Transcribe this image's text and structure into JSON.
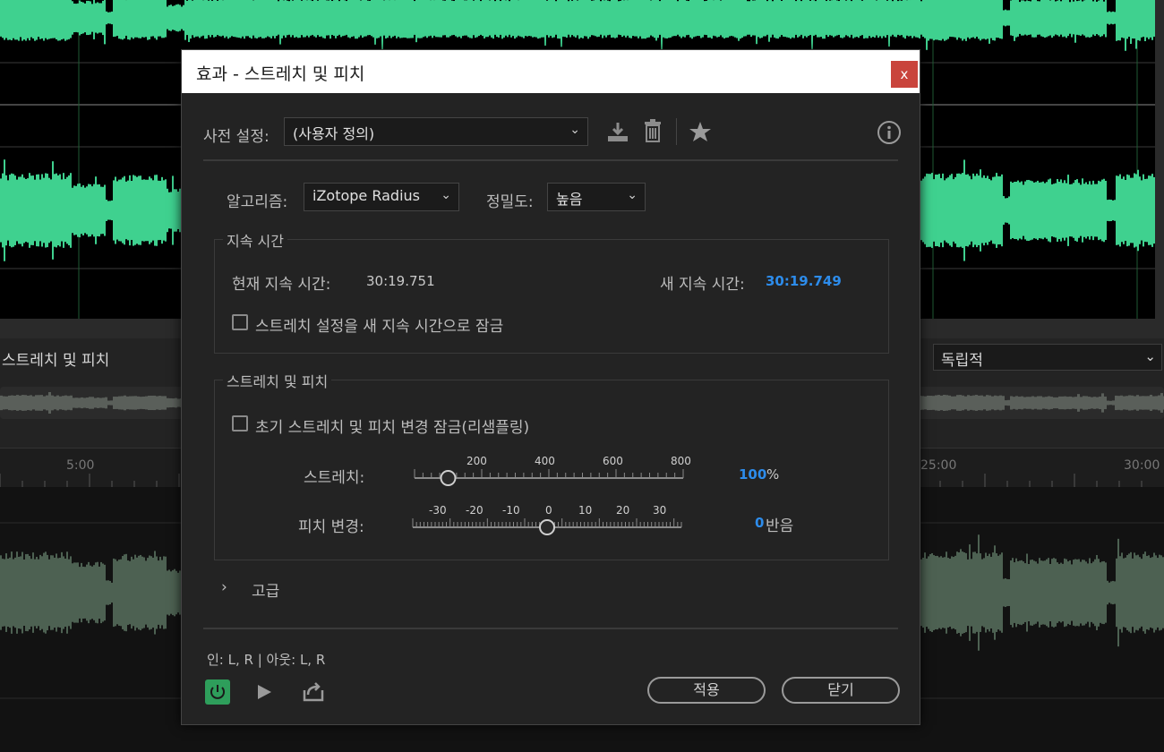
{
  "background": {
    "panel_label": "스트레치 및 피치",
    "right_select_value": "독립적",
    "ruler_labels": [
      "5:00",
      "25:00",
      "30:00"
    ]
  },
  "dialog": {
    "title": "효과 - 스트레치 및 피치",
    "close_label": "x",
    "preset": {
      "label": "사전 설정:",
      "value": "(사용자 정의)"
    },
    "algorithm": {
      "label": "알고리즘:",
      "value": "iZotope Radius"
    },
    "precision": {
      "label": "정밀도:",
      "value": "높음"
    },
    "duration_group": {
      "title": "지속 시간",
      "current_label": "현재 지속 시간:",
      "current_value": "30:19.751",
      "new_label": "새 지속 시간:",
      "new_value": "30:19.749",
      "lock_label": "스트레치 설정을 새 지속 시간으로 잠금"
    },
    "stretch_group": {
      "title": "스트레치 및 피치",
      "lock_label": "초기 스트레치 및 피치 변경 잠금(리샘플링)",
      "stretch_label": "스트레치:",
      "stretch_ticks": [
        "200",
        "400",
        "600",
        "800"
      ],
      "stretch_value": "100",
      "stretch_unit": "%",
      "stretch_level": 100,
      "pitch_label": "피치 변경:",
      "pitch_ticks": [
        "-30",
        "-20",
        "-10",
        "0",
        "10",
        "20",
        "30"
      ],
      "pitch_value": "0",
      "pitch_unit": "반음",
      "pitch_level": 0
    },
    "advanced_label": "고급",
    "channels_label": "인: L, R | 아웃: L, R",
    "apply_label": "적용",
    "close_button_label": "닫기",
    "colors": {
      "waveform": "#3fd18f",
      "accent_blue": "#2d8ceb",
      "power_green": "#2e9e5b",
      "close_red": "#c9443c"
    }
  }
}
